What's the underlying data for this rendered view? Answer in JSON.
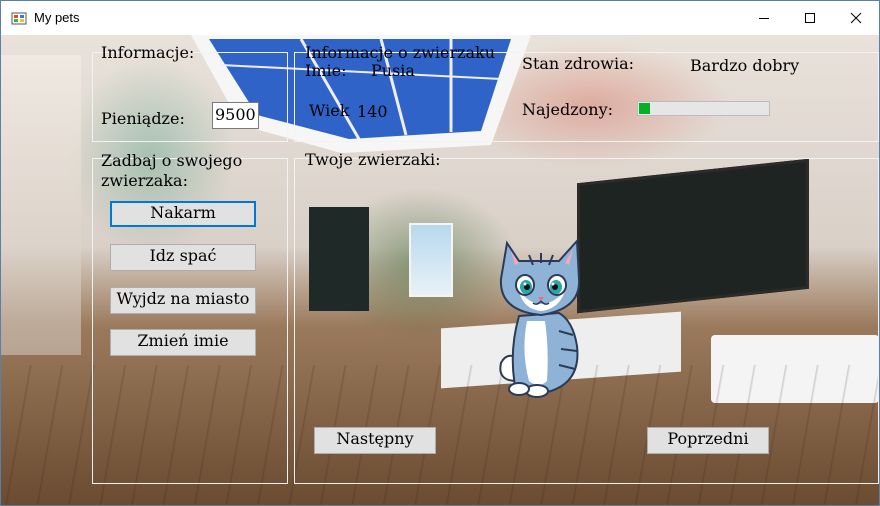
{
  "window": {
    "title": "My pets",
    "icons": {
      "app": "app-icon",
      "minimize": "minimize-icon",
      "maximize": "maximize-icon",
      "close": "close-icon"
    }
  },
  "info": {
    "group_label": "Informacje:",
    "money_label": "Pieniądze:",
    "money_value": "9500"
  },
  "pet_info": {
    "group_label": "Informacje o zwierzaku",
    "name_label": "Imie:",
    "name_value": "Pusia",
    "age_label": "Wiek",
    "age_value": "140",
    "health_label": "Stan zdrowia:",
    "health_value": "Bardzo dobry",
    "fed_label": "Najedzony:",
    "fed_level": 0.1
  },
  "care": {
    "group_label_line1": "Zadbaj o swojego",
    "group_label_line2": "zwierzaka:",
    "buttons": {
      "feed": "Nakarm",
      "sleep": "Idz spać",
      "go_out": "Wyjdz na miasto",
      "rename": "Zmień imie"
    }
  },
  "pets": {
    "group_label": "Twoje zwierzaki:",
    "next_label": "Następny",
    "prev_label": "Poprzedni"
  },
  "colors": {
    "progress_fill": "#06b025",
    "focus_border": "#0078d7",
    "button_bg": "#e1e1e1"
  }
}
